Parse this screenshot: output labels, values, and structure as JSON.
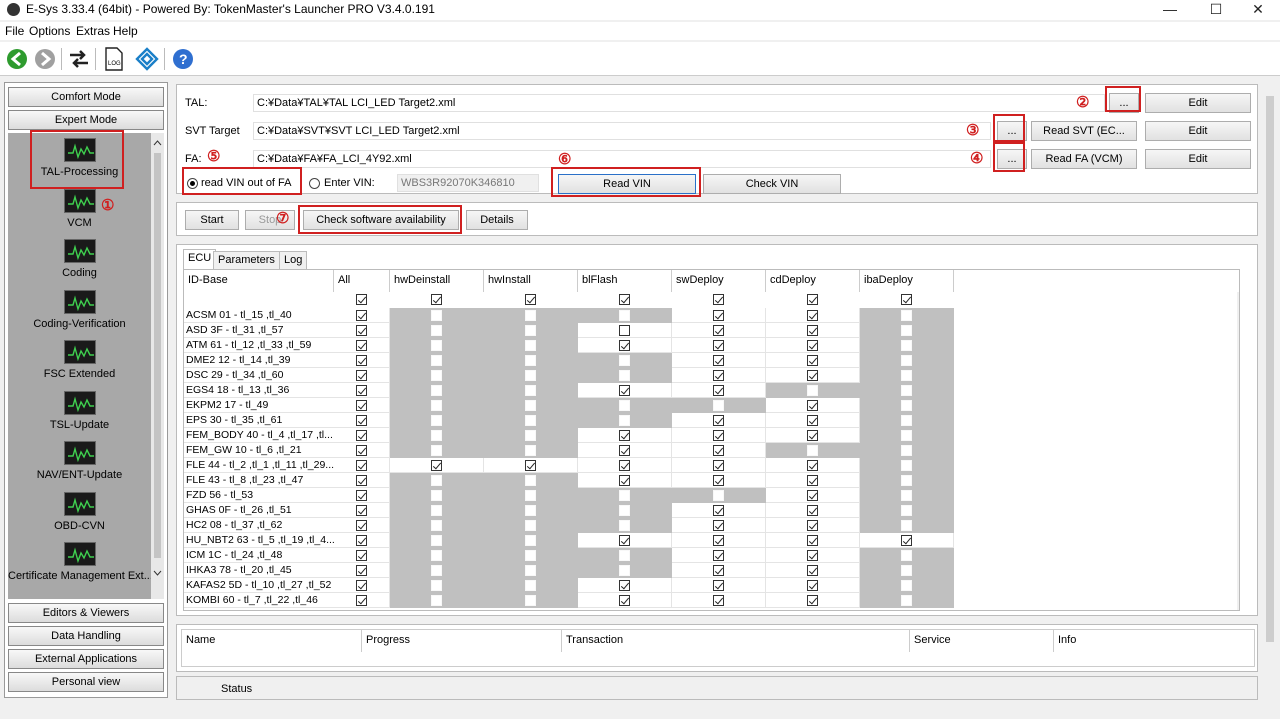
{
  "window": {
    "title": "E-Sys 3.33.4  (64bit) - Powered By: TokenMaster's Launcher PRO V3.4.0.191",
    "minimize": "—",
    "maximize": "☐",
    "close": "✕"
  },
  "menu": [
    "File",
    "Options",
    "Extras",
    "Help"
  ],
  "toolbar": {
    "icons": [
      "back-arrow-icon",
      "forward-arrow-icon",
      "connection-icon",
      "log-file-icon",
      "ecu-network-icon",
      "help-icon"
    ],
    "log_label": "LOG",
    "help_glyph": "?"
  },
  "sidebar": {
    "top_buttons": [
      "Comfort Mode",
      "Expert Mode"
    ],
    "modules": [
      "TAL-Processing",
      "VCM",
      "Coding",
      "Coding-Verification",
      "FSC Extended",
      "TSL-Update",
      "NAV/ENT-Update",
      "OBD-CVN",
      "Certificate Management Ext..."
    ],
    "bottom_buttons": [
      "Editors & Viewers",
      "Data Handling",
      "External Applications",
      "Personal view"
    ]
  },
  "files": {
    "tal_label": "TAL:",
    "tal_path": "C:¥Data¥TAL¥TAL LCI_LED Target2.xml",
    "svt_label": "SVT Target",
    "svt_path": "C:¥Data¥SVT¥SVT LCI_LED Target2.xml",
    "fa_label": "FA:",
    "fa_path": "C:¥Data¥FA¥FA_LCI_4Y92.xml",
    "browse": "...",
    "read_svt": "Read SVT (EC...",
    "read_fa": "Read FA (VCM)",
    "edit": "Edit"
  },
  "vin": {
    "option_fa": "read VIN out of FA",
    "option_enter": "Enter VIN:",
    "vin_value": "WBS3R92070K346810",
    "read_vin": "Read VIN",
    "check_vin": "Check VIN"
  },
  "actions": {
    "start": "Start",
    "stop": "Stop",
    "check_sw": "Check software availability",
    "details": "Details"
  },
  "annotations": [
    "①",
    "②",
    "③",
    "④",
    "⑤",
    "⑥",
    "⑦"
  ],
  "tabs": [
    "ECU",
    "Parameters",
    "Log"
  ],
  "grid": {
    "columns": [
      "ID-Base",
      "All",
      "hwDeinstall",
      "hwInstall",
      "blFlash",
      "swDeploy",
      "cdDeploy",
      "ibaDeploy"
    ],
    "header_checks": [
      1,
      1,
      1,
      1,
      1,
      1,
      1
    ],
    "rows": [
      {
        "name": "ACSM 01 - tl_15 ,tl_40",
        "c": [
          1,
          2,
          2,
          2,
          1,
          1,
          2
        ]
      },
      {
        "name": "ASD 3F - tl_31 ,tl_57",
        "c": [
          1,
          2,
          2,
          0,
          1,
          1,
          2
        ]
      },
      {
        "name": "ATM 61 - tl_12 ,tl_33 ,tl_59",
        "c": [
          1,
          2,
          2,
          1,
          1,
          1,
          2
        ]
      },
      {
        "name": "DME2 12 - tl_14 ,tl_39",
        "c": [
          1,
          2,
          2,
          2,
          1,
          1,
          2
        ]
      },
      {
        "name": "DSC 29 - tl_34 ,tl_60",
        "c": [
          1,
          2,
          2,
          2,
          1,
          1,
          2
        ]
      },
      {
        "name": "EGS4 18 - tl_13 ,tl_36",
        "c": [
          1,
          2,
          2,
          1,
          1,
          2,
          2
        ]
      },
      {
        "name": "EKPM2 17 - tl_49",
        "c": [
          1,
          2,
          2,
          2,
          2,
          1,
          2
        ]
      },
      {
        "name": "EPS 30 - tl_35 ,tl_61",
        "c": [
          1,
          2,
          2,
          2,
          1,
          1,
          2
        ]
      },
      {
        "name": "FEM_BODY 40 - tl_4 ,tl_17 ,tl...",
        "c": [
          1,
          2,
          2,
          1,
          1,
          1,
          2
        ]
      },
      {
        "name": "FEM_GW 10 - tl_6 ,tl_21",
        "c": [
          1,
          2,
          2,
          1,
          1,
          2,
          2
        ]
      },
      {
        "name": "FLE 44 - tl_2 ,tl_1 ,tl_11 ,tl_29...",
        "c": [
          1,
          1,
          1,
          1,
          1,
          1,
          2
        ]
      },
      {
        "name": "FLE 43 - tl_8 ,tl_23 ,tl_47",
        "c": [
          1,
          2,
          2,
          1,
          1,
          1,
          2
        ]
      },
      {
        "name": "FZD 56 - tl_53",
        "c": [
          1,
          2,
          2,
          2,
          2,
          1,
          2
        ]
      },
      {
        "name": "GHAS 0F - tl_26 ,tl_51",
        "c": [
          1,
          2,
          2,
          2,
          1,
          1,
          2
        ]
      },
      {
        "name": "HC2 08 - tl_37 ,tl_62",
        "c": [
          1,
          2,
          2,
          2,
          1,
          1,
          2
        ]
      },
      {
        "name": "HU_NBT2 63 - tl_5 ,tl_19 ,tl_4...",
        "c": [
          1,
          2,
          2,
          1,
          1,
          1,
          1
        ]
      },
      {
        "name": "ICM 1C - tl_24 ,tl_48",
        "c": [
          1,
          2,
          2,
          2,
          1,
          1,
          2
        ]
      },
      {
        "name": "IHKA3 78 - tl_20 ,tl_45",
        "c": [
          1,
          2,
          2,
          2,
          1,
          1,
          2
        ]
      },
      {
        "name": "KAFAS2 5D - tl_10 ,tl_27 ,tl_52",
        "c": [
          1,
          2,
          2,
          1,
          1,
          1,
          2
        ]
      },
      {
        "name": "KOMBI 60 - tl_7 ,tl_22 ,tl_46",
        "c": [
          1,
          2,
          2,
          1,
          1,
          1,
          2
        ]
      }
    ]
  },
  "transaction_columns": [
    "Name",
    "Progress",
    "Transaction",
    "Service",
    "Info"
  ],
  "status_label": "Status",
  "colors": {
    "accent_red": "#d02020",
    "gray_cell": "#c0c0c0",
    "panel": "#a8a8a8"
  }
}
